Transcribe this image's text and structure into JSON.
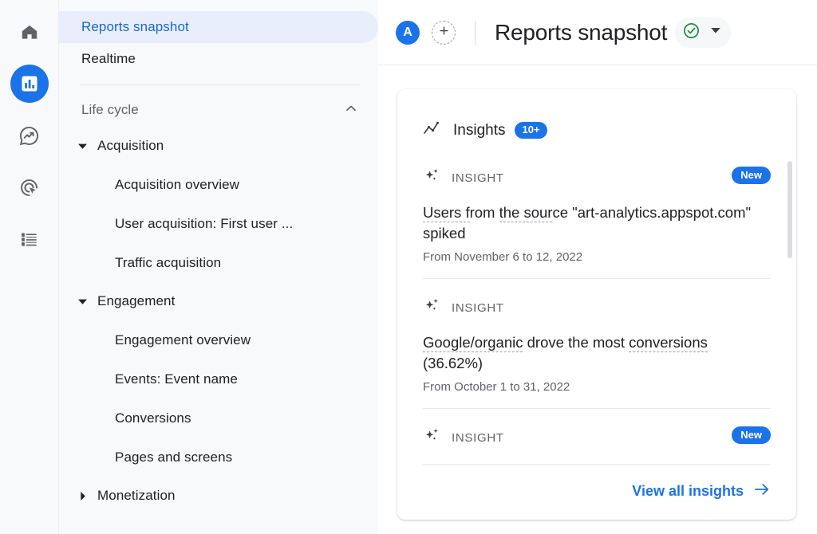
{
  "rail": {
    "items": [
      {
        "name": "home-icon",
        "label": "Home",
        "active": false
      },
      {
        "name": "reports-bar-chart-icon",
        "label": "Reports",
        "active": true
      },
      {
        "name": "explore-trend-icon",
        "label": "Explore",
        "active": false
      },
      {
        "name": "advertising-target-icon",
        "label": "Advertising",
        "active": false
      },
      {
        "name": "list-icon",
        "label": "Library",
        "active": false
      }
    ]
  },
  "sidebar": {
    "top_items": [
      {
        "label": "Reports snapshot",
        "active": true
      },
      {
        "label": "Realtime",
        "active": false
      }
    ],
    "section": {
      "label": "Life cycle",
      "chevron": "chevron-up-icon",
      "expanded": true
    },
    "groups": [
      {
        "label": "Acquisition",
        "expanded": true,
        "children": [
          "Acquisition overview",
          "User acquisition: First user ...",
          "Traffic acquisition"
        ]
      },
      {
        "label": "Engagement",
        "expanded": true,
        "children": [
          "Engagement overview",
          "Events: Event name",
          "Conversions",
          "Pages and screens"
        ]
      },
      {
        "label": "Monetization",
        "expanded": false,
        "children": []
      }
    ]
  },
  "topbar": {
    "avatar_letter": "A",
    "add_icon": "plus-icon",
    "title": "Reports snapshot",
    "status_icon": "check-circle-icon",
    "status_color": "#1e8e3e",
    "dropdown_icon": "chevron-down-icon"
  },
  "card": {
    "header": {
      "icon": "insights-trend-icon",
      "title": "Insights",
      "badge": "10+"
    },
    "insights": [
      {
        "icon": "sparkle-icon",
        "label": "INSIGHT",
        "badge": "New",
        "title_parts": [
          {
            "text": "Users f",
            "dotted": true
          },
          {
            "text": "rom ",
            "dotted": false
          },
          {
            "text": "the sour",
            "dotted": true
          },
          {
            "text": "ce \"art-analytics.appspot.com\" spiked",
            "dotted": false
          }
        ],
        "title_plain": "Users from the source \"art-analytics.appspot.com\" spiked",
        "date": "From November 6 to 12, 2022"
      },
      {
        "icon": "sparkle-icon",
        "label": "INSIGHT",
        "badge": "",
        "title_parts": [
          {
            "text": "Google/organic",
            "dotted": true
          },
          {
            "text": " drove the most ",
            "dotted": false
          },
          {
            "text": "conversions",
            "dotted": true
          },
          {
            "text": " (36.62%)",
            "dotted": false
          }
        ],
        "title_plain": "Google/organic drove the most conversions (36.62%)",
        "date": "From October 1 to 31, 2022"
      },
      {
        "icon": "sparkle-icon",
        "label": "INSIGHT",
        "badge": "New",
        "title_parts": [],
        "title_plain": "",
        "date": ""
      }
    ],
    "view_all": {
      "label": "View all insights",
      "icon": "arrow-right-icon"
    }
  },
  "colors": {
    "accent_blue": "#1a73e8",
    "active_nav_bg": "#e8eefc",
    "active_nav_text": "#1967d2",
    "green": "#1e8e3e",
    "text_primary": "#202124",
    "text_secondary": "#5f6368"
  }
}
